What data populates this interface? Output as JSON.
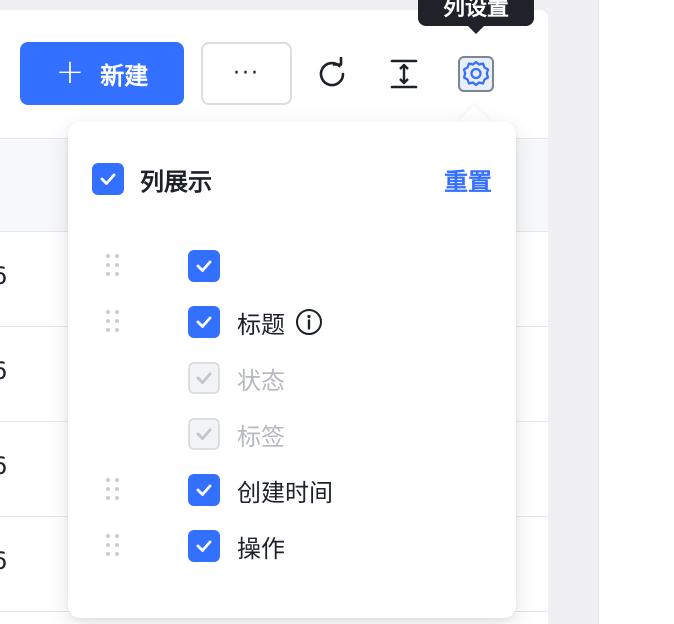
{
  "toolbar": {
    "new_label": "新建",
    "more_label": "···",
    "icons": {
      "plus": "plus-icon",
      "refresh": "refresh-icon",
      "row_height": "row-height-icon",
      "settings": "gear-icon"
    }
  },
  "tooltip": {
    "text": "列设置"
  },
  "table": {
    "rows": [
      "6",
      "6",
      "6",
      "6"
    ]
  },
  "column_settings": {
    "title": "列展示",
    "reset_label": "重置",
    "columns": [
      {
        "label": "",
        "checked": true,
        "disabled": false,
        "draggable": true,
        "has_info": false
      },
      {
        "label": "标题",
        "checked": true,
        "disabled": false,
        "draggable": true,
        "has_info": true
      },
      {
        "label": "状态",
        "checked": true,
        "disabled": true,
        "draggable": false,
        "has_info": false
      },
      {
        "label": "标签",
        "checked": true,
        "disabled": true,
        "draggable": false,
        "has_info": false
      },
      {
        "label": "创建时间",
        "checked": true,
        "disabled": false,
        "draggable": true,
        "has_info": false
      },
      {
        "label": "操作",
        "checked": true,
        "disabled": false,
        "draggable": true,
        "has_info": false
      }
    ]
  },
  "colors": {
    "primary": "#3370ff",
    "tooltip_bg": "#1f2329",
    "text": "#1d2129",
    "disabled_text": "#b6b9bf"
  }
}
